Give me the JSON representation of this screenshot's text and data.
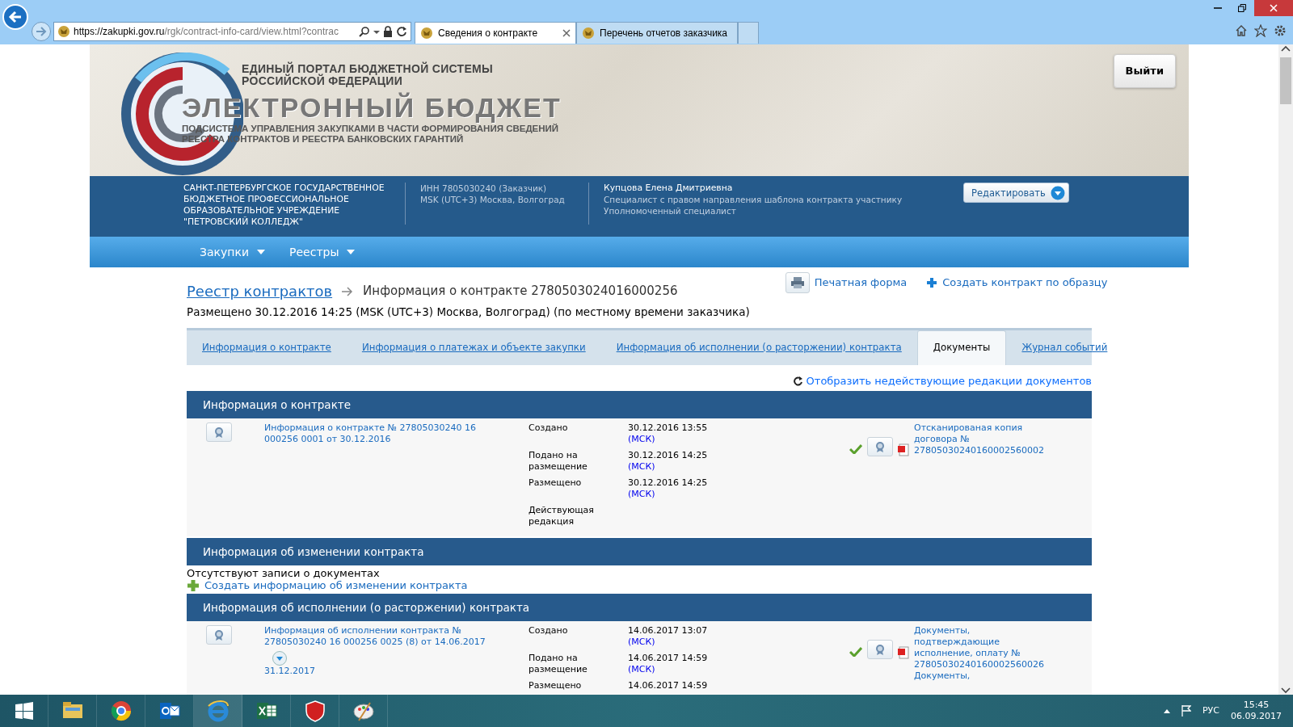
{
  "browser": {
    "address": {
      "host": "https://zakupki.gov.ru",
      "path": "/rgk/contract-info-card/view.html?contrac"
    },
    "tabs": [
      {
        "label": "Сведения о контракте",
        "selected": true
      },
      {
        "label": "Перечень отчетов заказчика",
        "selected": false
      }
    ]
  },
  "header": {
    "portal_lines": [
      "ЕДИНЫЙ ПОРТАЛ БЮДЖЕТНОЙ СИСТЕМЫ",
      "РОССИЙСКОЙ ФЕДЕРАЦИИ"
    ],
    "brand": "ЭЛЕКТРОННЫЙ БЮДЖЕТ",
    "subtitle_lines": [
      "ПОДСИСТЕМА УПРАВЛЕНИЯ ЗАКУПКАМИ В ЧАСТИ ФОРМИРОВАНИЯ СВЕДЕНИЙ",
      "РЕЕСТРА КОНТРАКТОВ И РЕЕСТРА БАНКОВСКИХ ГАРАНТИЙ"
    ],
    "logout_button": "Выйти"
  },
  "org_bar": {
    "organization": "САНКТ-ПЕТЕРБУРГСКОЕ ГОСУДАРСТВЕННОЕ БЮДЖЕТНОЕ ПРОФЕССИОНАЛЬНОЕ ОБРАЗОВАТЕЛЬНОЕ УЧРЕЖДЕНИЕ \"ПЕТРОВСКИЙ КОЛЛЕДЖ\"",
    "inn": "ИНН 7805030240 (Заказчик)",
    "timezone": "MSK (UTC+3) Москва, Волгоград",
    "user_name": "Купцова Елена Дмитриевна",
    "roles": [
      "Специалист с правом направления шаблона контракта участнику",
      "Уполномоченный специалист"
    ],
    "edit_button": "Редактировать"
  },
  "nav_menu": [
    "Закупки",
    "Реестры"
  ],
  "breadcrumb": {
    "link": "Реестр контрактов",
    "current": "Информация о контракте 2780503024016000256"
  },
  "posted": "Размещено 30.12.2016 14:25 (MSK (UTC+3) Москва, Волгоград) (по местному времени заказчика)",
  "actions": [
    {
      "kind": "print",
      "label": "Печатная форма"
    },
    {
      "kind": "create",
      "label": "Создать контракт по образцу"
    }
  ],
  "tabs": [
    {
      "label": "Информация о контракте",
      "selected": false
    },
    {
      "label": "Информация о платежах и объекте закупки",
      "selected": false
    },
    {
      "label": "Информация об исполнении (о расторжении) контракта",
      "selected": false
    },
    {
      "label": "Документы",
      "selected": true
    },
    {
      "label": "Журнал событий",
      "selected": false
    }
  ],
  "show_inactive_link": "Отобразить недействующие редакции документов",
  "sections": [
    {
      "title": "Информация о контракте",
      "rows": [
        {
          "document": "Информация о контракте № 27805030240 16 000256 0001 от 30.12.2016",
          "fields": [
            {
              "label": "Создано",
              "value": "30.12.2016 13:55",
              "zone": "(МСК)"
            },
            {
              "label": "Подано на размещение",
              "value": "30.12.2016 14:25",
              "zone": "(МСК)"
            },
            {
              "label": "Размещено",
              "value": "30.12.2016 14:25",
              "zone": "(МСК)"
            },
            {
              "label": "Действующая редакция"
            }
          ],
          "verified": true,
          "attachments": [
            "Отсканированая копия договора № 27805030240160002560002"
          ]
        }
      ]
    },
    {
      "title": "Информация об изменении контракта",
      "empty_text": "Отсутствуют записи о документах",
      "create_link": "Создать информацию об изменении контракта"
    },
    {
      "title": "Информация об исполнении (о расторжении) контракта",
      "rows": [
        {
          "document": "Информация об исполнении контракта № 27805030240 16 000256 0025 (8) от 14.06.2017",
          "expandable": true,
          "date": "31.12.2017",
          "fields": [
            {
              "label": "Создано",
              "value": "14.06.2017 13:07",
              "zone": "(МСК)"
            },
            {
              "label": "Подано на размещение",
              "value": "14.06.2017 14:59",
              "zone": "(МСК)"
            },
            {
              "label": "Размещено",
              "value": "14.06.2017 14:59"
            }
          ],
          "verified": true,
          "attachments": [
            "Документы, подтверждающие исполнение, оплату № 27805030240160002560026",
            "Документы,"
          ]
        }
      ]
    }
  ],
  "taskbar": {
    "language": "РУС",
    "time": "15:45",
    "date": "06.09.2017"
  }
}
